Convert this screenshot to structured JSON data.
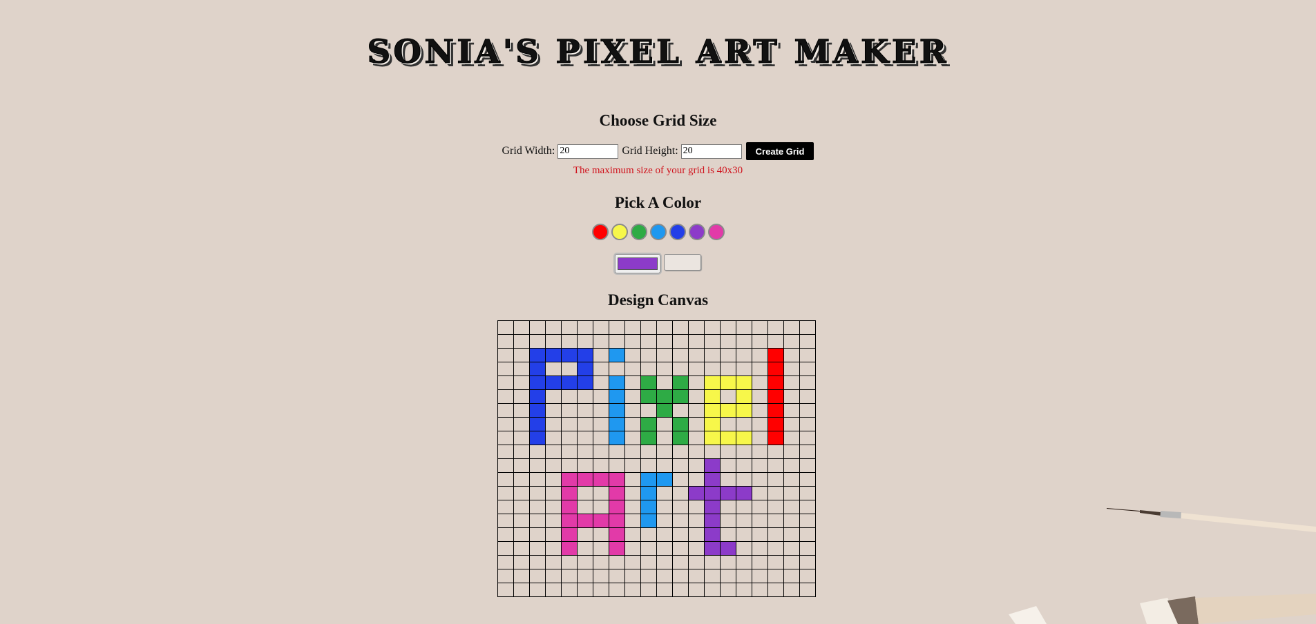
{
  "app": {
    "title": "SONIA'S PIXEL ART MAKER"
  },
  "grid_section": {
    "heading": "Choose Grid Size",
    "width_label": "Grid Width:",
    "width_value": "20",
    "height_label": "Grid Height:",
    "height_value": "20",
    "create_label": "Create Grid",
    "max_note": "The maximum size of your grid is 40x30"
  },
  "color_section": {
    "heading": "Pick A Color",
    "swatches": [
      {
        "name": "red",
        "hex": "#ff0000"
      },
      {
        "name": "yellow",
        "hex": "#f7f74a"
      },
      {
        "name": "green",
        "hex": "#2eab45"
      },
      {
        "name": "light-blue",
        "hex": "#1f98f0"
      },
      {
        "name": "blue",
        "hex": "#233fe8"
      },
      {
        "name": "purple",
        "hex": "#8c3bc9"
      },
      {
        "name": "pink",
        "hex": "#e23aa8"
      }
    ],
    "selected_color": "#8c3bc9"
  },
  "canvas_section": {
    "heading": "Design Canvas",
    "columns": 20,
    "rows": 20,
    "painted": [
      {
        "color": "#233fe8",
        "cells": [
          [
            2,
            2
          ],
          [
            2,
            3
          ],
          [
            2,
            4
          ],
          [
            2,
            5
          ],
          [
            3,
            2
          ],
          [
            3,
            5
          ],
          [
            4,
            2
          ],
          [
            4,
            3
          ],
          [
            4,
            4
          ],
          [
            4,
            5
          ],
          [
            5,
            2
          ],
          [
            6,
            2
          ],
          [
            7,
            2
          ],
          [
            8,
            2
          ]
        ]
      },
      {
        "color": "#1f98f0",
        "cells": [
          [
            2,
            7
          ],
          [
            4,
            7
          ],
          [
            5,
            7
          ],
          [
            6,
            7
          ],
          [
            7,
            7
          ],
          [
            8,
            7
          ],
          [
            11,
            9
          ],
          [
            11,
            10
          ],
          [
            12,
            9
          ],
          [
            13,
            9
          ],
          [
            14,
            9
          ]
        ]
      },
      {
        "color": "#2eab45",
        "cells": [
          [
            4,
            9
          ],
          [
            4,
            11
          ],
          [
            5,
            9
          ],
          [
            5,
            10
          ],
          [
            5,
            11
          ],
          [
            6,
            10
          ],
          [
            7,
            9
          ],
          [
            7,
            11
          ],
          [
            8,
            9
          ],
          [
            8,
            11
          ]
        ]
      },
      {
        "color": "#f7f74a",
        "cells": [
          [
            4,
            13
          ],
          [
            4,
            14
          ],
          [
            4,
            15
          ],
          [
            5,
            13
          ],
          [
            5,
            15
          ],
          [
            6,
            13
          ],
          [
            6,
            14
          ],
          [
            6,
            15
          ],
          [
            7,
            13
          ],
          [
            8,
            13
          ],
          [
            8,
            14
          ],
          [
            8,
            15
          ]
        ]
      },
      {
        "color": "#ff0000",
        "cells": [
          [
            2,
            17
          ],
          [
            3,
            17
          ],
          [
            4,
            17
          ],
          [
            5,
            17
          ],
          [
            6,
            17
          ],
          [
            7,
            17
          ],
          [
            8,
            17
          ]
        ]
      },
      {
        "color": "#e23aa8",
        "cells": [
          [
            11,
            4
          ],
          [
            11,
            5
          ],
          [
            11,
            6
          ],
          [
            11,
            7
          ],
          [
            12,
            4
          ],
          [
            12,
            7
          ],
          [
            13,
            4
          ],
          [
            13,
            7
          ],
          [
            14,
            4
          ],
          [
            14,
            5
          ],
          [
            14,
            6
          ],
          [
            14,
            7
          ],
          [
            15,
            4
          ],
          [
            15,
            7
          ],
          [
            16,
            4
          ],
          [
            16,
            7
          ]
        ]
      },
      {
        "color": "#8c3bc9",
        "cells": [
          [
            10,
            13
          ],
          [
            11,
            13
          ],
          [
            12,
            12
          ],
          [
            12,
            13
          ],
          [
            12,
            14
          ],
          [
            12,
            15
          ],
          [
            13,
            13
          ],
          [
            14,
            13
          ],
          [
            15,
            13
          ],
          [
            16,
            13
          ],
          [
            16,
            14
          ]
        ]
      }
    ]
  }
}
